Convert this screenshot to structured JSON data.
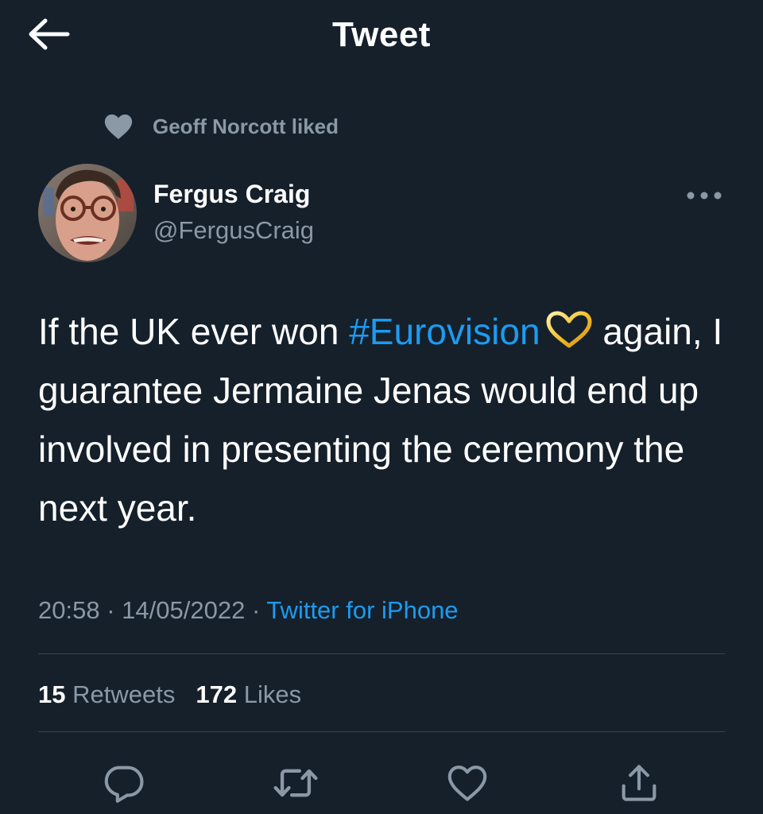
{
  "header": {
    "title": "Tweet",
    "back_icon": "arrow-left-icon"
  },
  "social_context": {
    "text": "Geoff Norcott liked",
    "icon": "heart-filled-icon"
  },
  "author": {
    "name": "Fergus Craig",
    "handle": "@FergusCraig",
    "more_icon": "more-horizontal-icon"
  },
  "tweet": {
    "text_before": "If the UK ever won ",
    "hashtag": "#Eurovision",
    "text_after": " again, I guarantee Jermaine Jenas would end up involved in presenting the ceremony the next year.",
    "hashtag_emoji": "gold-heart-emoji"
  },
  "meta": {
    "time": "20:58",
    "separator": "·",
    "date": "14/05/2022",
    "source": "Twitter for iPhone"
  },
  "stats": {
    "retweets_count": "15",
    "retweets_label": "Retweets",
    "likes_count": "172",
    "likes_label": "Likes"
  },
  "actions": [
    {
      "icon": "reply-icon"
    },
    {
      "icon": "retweet-icon"
    },
    {
      "icon": "like-icon"
    },
    {
      "icon": "share-icon"
    }
  ],
  "colors": {
    "background": "#15202b",
    "text_primary": "#ffffff",
    "text_secondary": "#8b98a5",
    "accent": "#1d9bf0",
    "divider": "#38444d"
  }
}
